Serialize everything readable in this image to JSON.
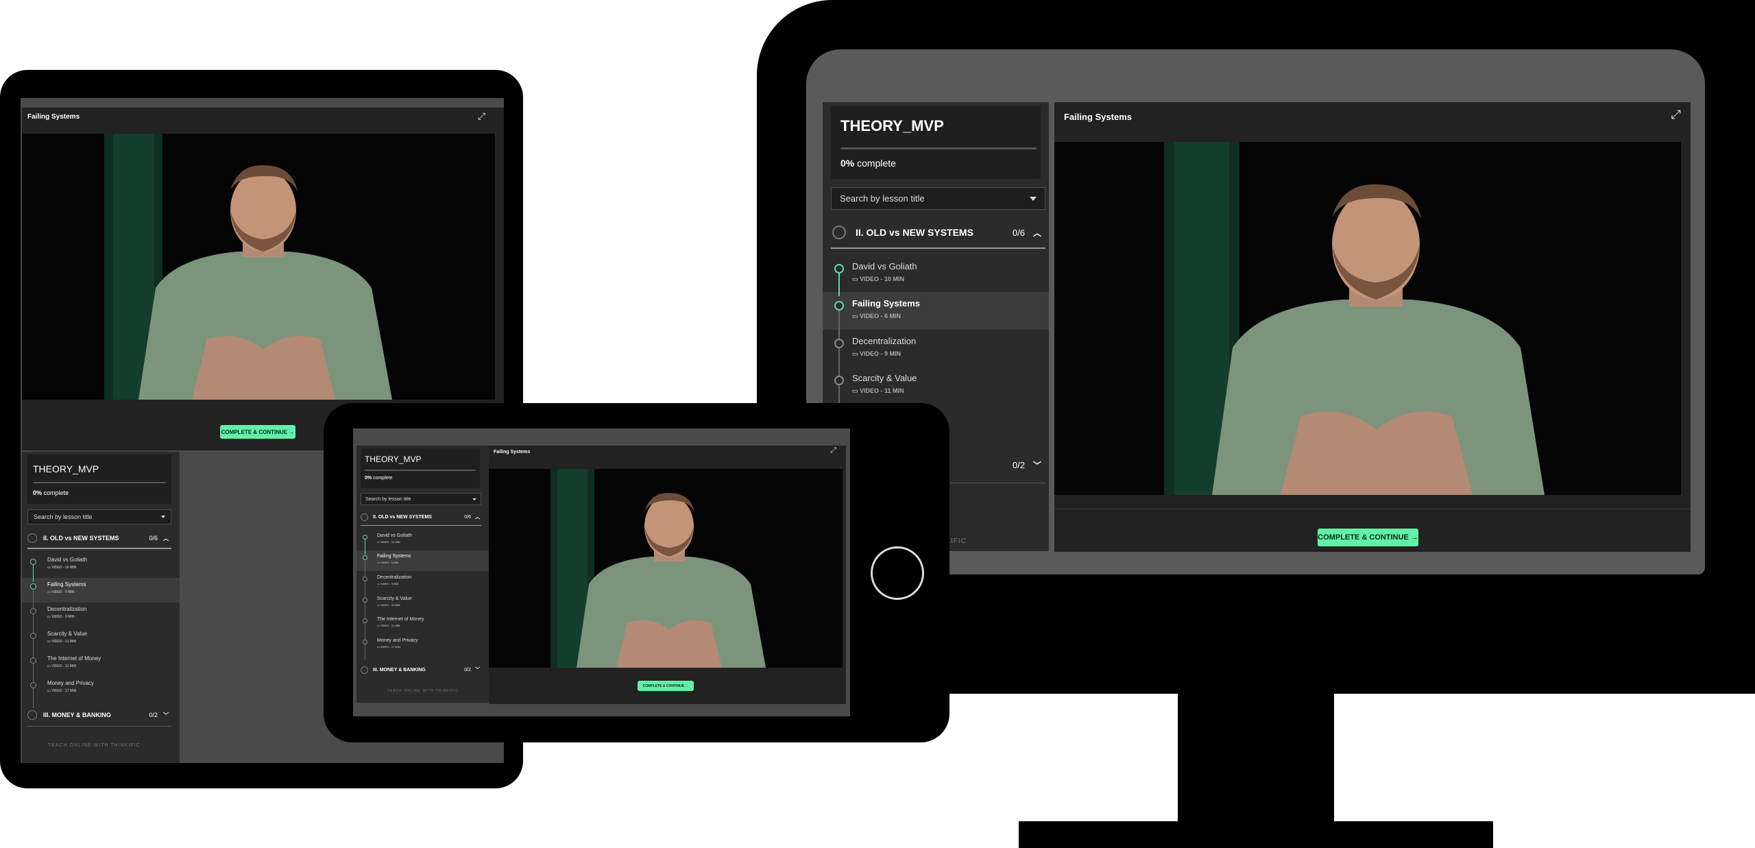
{
  "course": {
    "title": "THEORY_MVP",
    "progress_pct": "0%",
    "progress_label": "complete",
    "search_placeholder": "Search by lesson title",
    "chapter_1": {
      "title": "II. OLD vs NEW SYSTEMS",
      "count": "0/6"
    },
    "chapter_2": {
      "title": "III. MONEY & BANKING",
      "count": "0/2"
    },
    "lessons": [
      {
        "title": "David vs Goliath",
        "meta": "VIDEO - 10 MIN"
      },
      {
        "title": "Failing Systems",
        "meta": "VIDEO - 6 MIN"
      },
      {
        "title": "Decentralization",
        "meta": "VIDEO - 9 MIN"
      },
      {
        "title": "Scarcity & Value",
        "meta": "VIDEO - 11 MIN"
      },
      {
        "title": "The Internet of Money",
        "meta": "VIDEO - 11 MIN"
      },
      {
        "title": "Money and Privacy",
        "meta": "VIDEO - 17 MIN"
      }
    ],
    "footer": "TEACH ONLINE WITH THINKIFIC",
    "footer_partial": "THINKIFIC",
    "desktop_partial_chapter": "G",
    "desktop_partial_lesson": "y"
  },
  "player": {
    "lesson_title": "Failing Systems",
    "cta_label": "COMPLETE & CONTINUE →"
  },
  "colors": {
    "accent": "#62f0a8",
    "active_dot": "#62d8a3",
    "sidebar": "#2b2b2b",
    "device": "#000000"
  }
}
